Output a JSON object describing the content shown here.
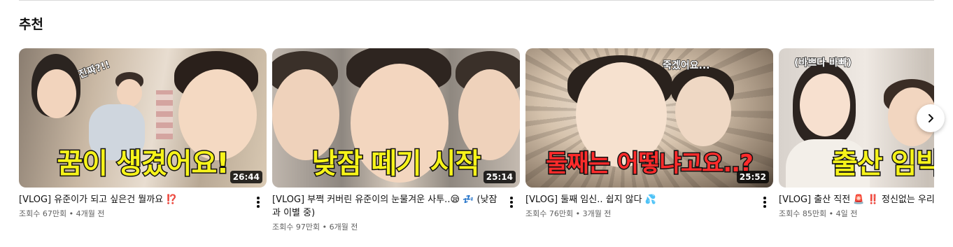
{
  "section": {
    "title": "추천"
  },
  "videos": [
    {
      "overlay_text": "꿈이 생겼어요!",
      "small_tag": "진짜?!!",
      "duration": "26:44",
      "title": "[VLOG] 유준이가 되고 싶은건 뭘까요 ⁉️",
      "stats": "조회수 67만회 • 4개월 전",
      "overlay_color": "#f6f31a"
    },
    {
      "overlay_text": "낮잠 떼기 시작",
      "small_tag": "",
      "duration": "25:14",
      "title": "[VLOG] 부쩍 커버린 유준이의 눈물겨운 사투..😪 💤 (낮잠과 이별 중)",
      "stats": "조회수 97만회 • 6개월 전",
      "overlay_color": "#f6f31a"
    },
    {
      "overlay_text": "둘째는 어떻냐고요..?",
      "small_tag": "죽겠어요...",
      "duration": "25:52",
      "title": "[VLOG] 둘째 임신.. 쉽지 않다 💦",
      "stats": "조회수 76만회 • 3개월 전",
      "overlay_color": "#ff2b2b"
    },
    {
      "overlay_text": "출산 임박",
      "small_tag": "(바쁘다 바빠)",
      "duration": "",
      "title": "[VLOG] 출산 직전 🚨 ‼️ 정신없는 우리",
      "stats": "조회수 85만회 • 4일 전",
      "overlay_color": "#f6f31a"
    }
  ],
  "icons": {
    "more": "kebab-vertical-icon",
    "next": "chevron-right-icon"
  }
}
